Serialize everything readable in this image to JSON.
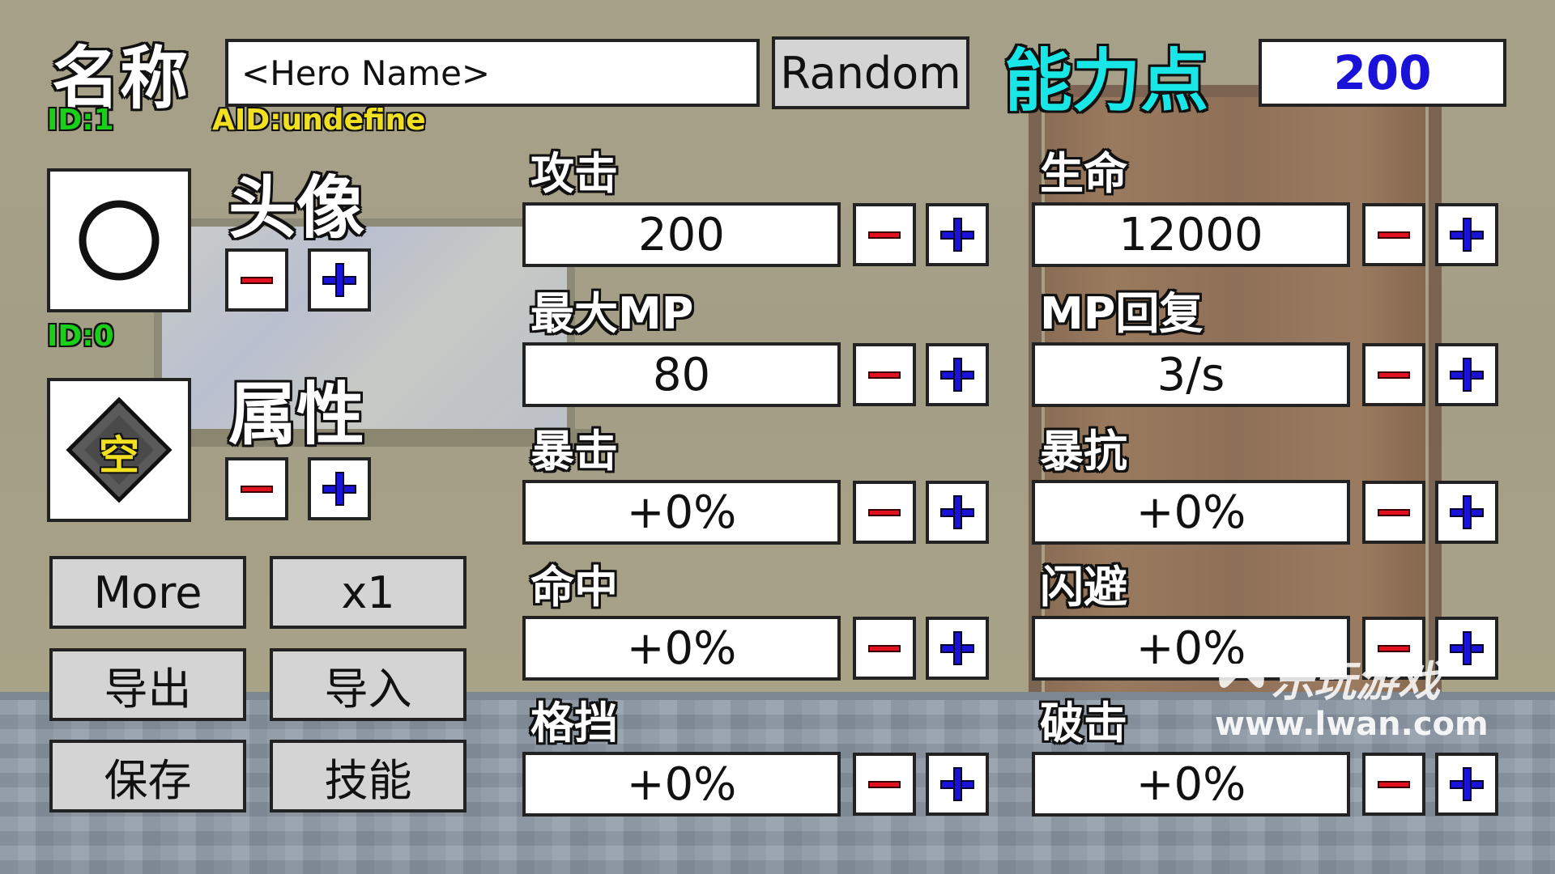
{
  "header": {
    "name_label": "名称",
    "name_placeholder": "<Hero Name>",
    "random_label": "Random",
    "points_label": "能力点",
    "points_value": "200",
    "id_tag": "ID:1",
    "aid_tag": "AID:undefine"
  },
  "portrait": {
    "label": "头像",
    "id_tag": "ID:0",
    "icon": "circle-outline-icon"
  },
  "attribute": {
    "label": "属性",
    "badge_text": "空",
    "icon": "diamond-badge-icon"
  },
  "buttons": {
    "more": "More",
    "multiplier": "x1",
    "export": "导出",
    "import": "导入",
    "save": "保存",
    "skills": "技能"
  },
  "stats": [
    {
      "label": "攻击",
      "value": "200"
    },
    {
      "label": "生命",
      "value": "12000"
    },
    {
      "label": "最大MP",
      "value": "80"
    },
    {
      "label": "MP回复",
      "value": "3/s"
    },
    {
      "label": "暴击",
      "value": "+0%"
    },
    {
      "label": "暴抗",
      "value": "+0%"
    },
    {
      "label": "命中",
      "value": "+0%"
    },
    {
      "label": "闪避",
      "value": "+0%"
    },
    {
      "label": "格挡",
      "value": "+0%"
    },
    {
      "label": "破击",
      "value": "+0%"
    }
  ],
  "watermark": {
    "brand": "乐玩游戏",
    "url": "www.lwan.com"
  },
  "colors": {
    "minus": "#e1111f",
    "plus": "#1a12d8",
    "points_label": "#19e6e6",
    "points_value": "#1a12d8",
    "id_tag": "#18d018",
    "aid_tag": "#f0e020"
  }
}
